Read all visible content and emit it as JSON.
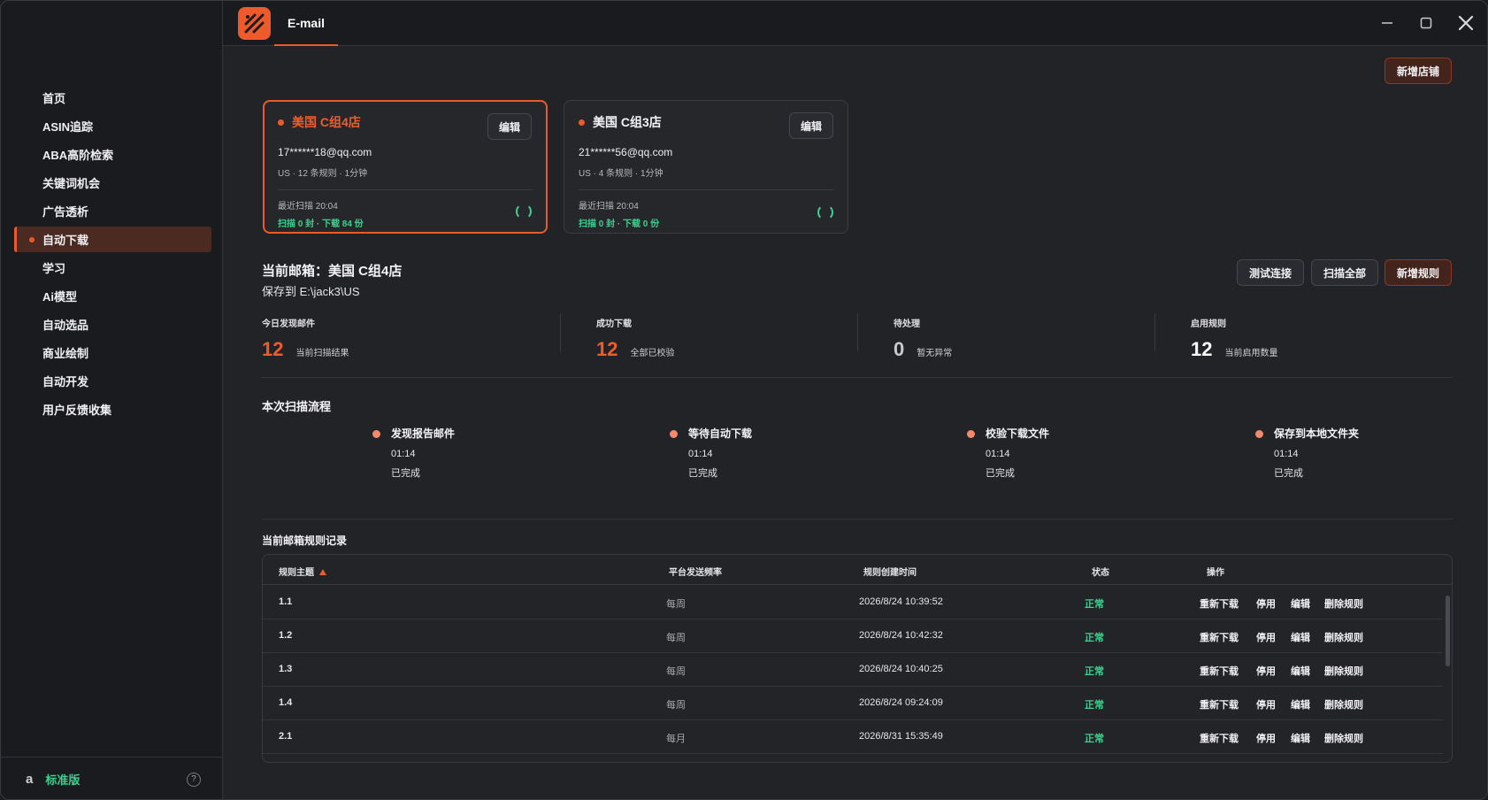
{
  "app": {
    "tab_title": "E-mail"
  },
  "sidebar": {
    "items": [
      {
        "label": "首页"
      },
      {
        "label": "ASIN追踪"
      },
      {
        "label": "ABA高阶检索"
      },
      {
        "label": "关键词机会"
      },
      {
        "label": "广告透析"
      },
      {
        "label": "自动下载",
        "active": true
      },
      {
        "label": "学习"
      },
      {
        "label": "Ai模型"
      },
      {
        "label": "自动选品"
      },
      {
        "label": "商业绘制"
      },
      {
        "label": "自动开发"
      },
      {
        "label": "用户反馈收集"
      }
    ],
    "edition": "标准版",
    "amazon_icon": "a",
    "help_icon": "?"
  },
  "toolbar": {
    "add_store_label": "新增店铺"
  },
  "stores": [
    {
      "name": "美国 C组4店",
      "edit_label": "编辑",
      "email": "17******18@qq.com",
      "meta": "US · 12 条规则 · 1分钟",
      "last_scan": "最近扫描 20:04",
      "stats": "扫描 0 封 · 下载 84 份",
      "active": true
    },
    {
      "name": "美国 C组3店",
      "edit_label": "编辑",
      "email": "21******56@qq.com",
      "meta": "US · 4 条规则 · 1分钟",
      "last_scan": "最近扫描 20:04",
      "stats": "扫描 0 封 · 下载 0 份",
      "active": false
    }
  ],
  "current": {
    "title": "当前邮箱：美国 C组4店",
    "save_path": "保存到 E:\\jack3\\US",
    "test_label": "测试连接",
    "scan_all_label": "扫描全部",
    "add_rule_label": "新增规则"
  },
  "stats": [
    {
      "label": "今日发现邮件",
      "value": "12",
      "desc": "当前扫描结果"
    },
    {
      "label": "成功下载",
      "value": "12",
      "desc": "全部已校验"
    },
    {
      "label": "待处理",
      "value": "0",
      "desc": "暂无异常"
    },
    {
      "label": "启用规则",
      "value": "12",
      "desc": "当前启用数量"
    }
  ],
  "flow": {
    "title": "本次扫描流程",
    "steps": [
      {
        "name": "发现报告邮件",
        "time": "01:14",
        "status": "已完成"
      },
      {
        "name": "等待自动下载",
        "time": "01:14",
        "status": "已完成"
      },
      {
        "name": "校验下载文件",
        "time": "01:14",
        "status": "已完成"
      },
      {
        "name": "保存到本地文件夹",
        "time": "01:14",
        "status": "已完成"
      }
    ]
  },
  "rules": {
    "title": "当前邮箱规则记录",
    "columns": [
      "规则主题",
      "平台发送频率",
      "规则创建时间",
      "状态",
      "操作"
    ],
    "actions": [
      "重新下载",
      "停用",
      "编辑",
      "删除规则"
    ],
    "rows": [
      {
        "topic": "1.1",
        "freq": "每周",
        "created": "2026/8/24 10:39:52",
        "status": "正常"
      },
      {
        "topic": "1.2",
        "freq": "每周",
        "created": "2026/8/24 10:42:32",
        "status": "正常"
      },
      {
        "topic": "1.3",
        "freq": "每周",
        "created": "2026/8/24 10:40:25",
        "status": "正常"
      },
      {
        "topic": "1.4",
        "freq": "每周",
        "created": "2026/8/24 09:24:09",
        "status": "正常"
      },
      {
        "topic": "2.1",
        "freq": "每月",
        "created": "2026/8/31 15:35:49",
        "status": "正常"
      }
    ]
  },
  "colors": {
    "accent": "#ec5a2b",
    "success": "#3fcf8e",
    "background": "#222327",
    "sidebar": "#1a1b1e"
  }
}
